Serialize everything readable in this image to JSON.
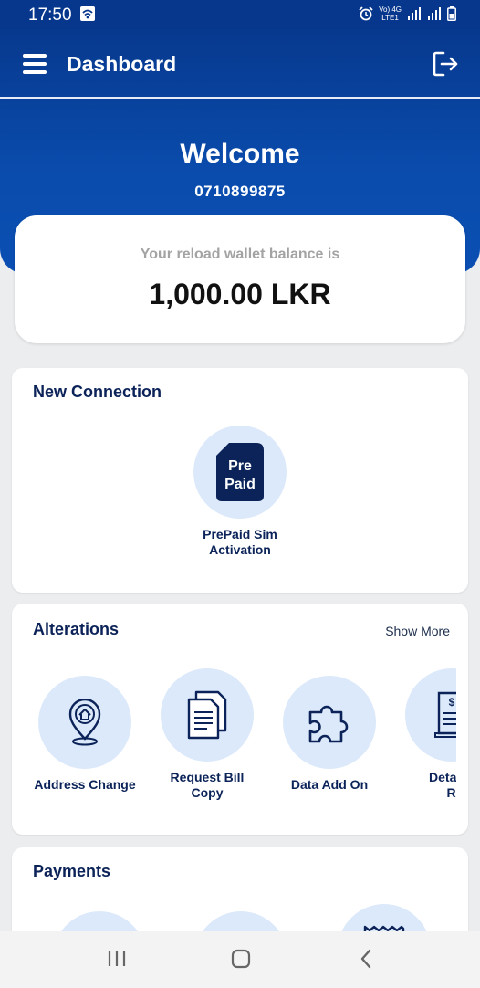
{
  "status": {
    "time": "17:50",
    "lte_top": "Vo) 4G",
    "lte_bottom": "LTE1"
  },
  "appbar": {
    "title": "Dashboard"
  },
  "header": {
    "welcome": "Welcome",
    "phone": "0710899875"
  },
  "balance": {
    "label": "Your reload wallet balance is",
    "value": "1,000.00 LKR"
  },
  "new_connection": {
    "title": "New Connection",
    "items": [
      {
        "icon": "prepaid-sim-icon",
        "label_line1": "PrePaid Sim",
        "label_line2": "Activation",
        "icon_text_1": "Pre",
        "icon_text_2": "Paid"
      }
    ]
  },
  "alterations": {
    "title": "Alterations",
    "show_more": "Show More",
    "items": [
      {
        "icon": "location-home-icon",
        "label": "Address Change"
      },
      {
        "icon": "document-copy-icon",
        "label_line1": "Request Bill",
        "label_line2": "Copy"
      },
      {
        "icon": "puzzle-icon",
        "label": "Data Add On"
      },
      {
        "icon": "bill-receipt-icon",
        "label_line1": "Detaile",
        "label_line2": "Requ"
      }
    ]
  },
  "payments": {
    "title": "Payments"
  },
  "colors": {
    "primary": "#07378d",
    "accent_circle": "#dce9fa",
    "text_dark": "#0b2358"
  }
}
